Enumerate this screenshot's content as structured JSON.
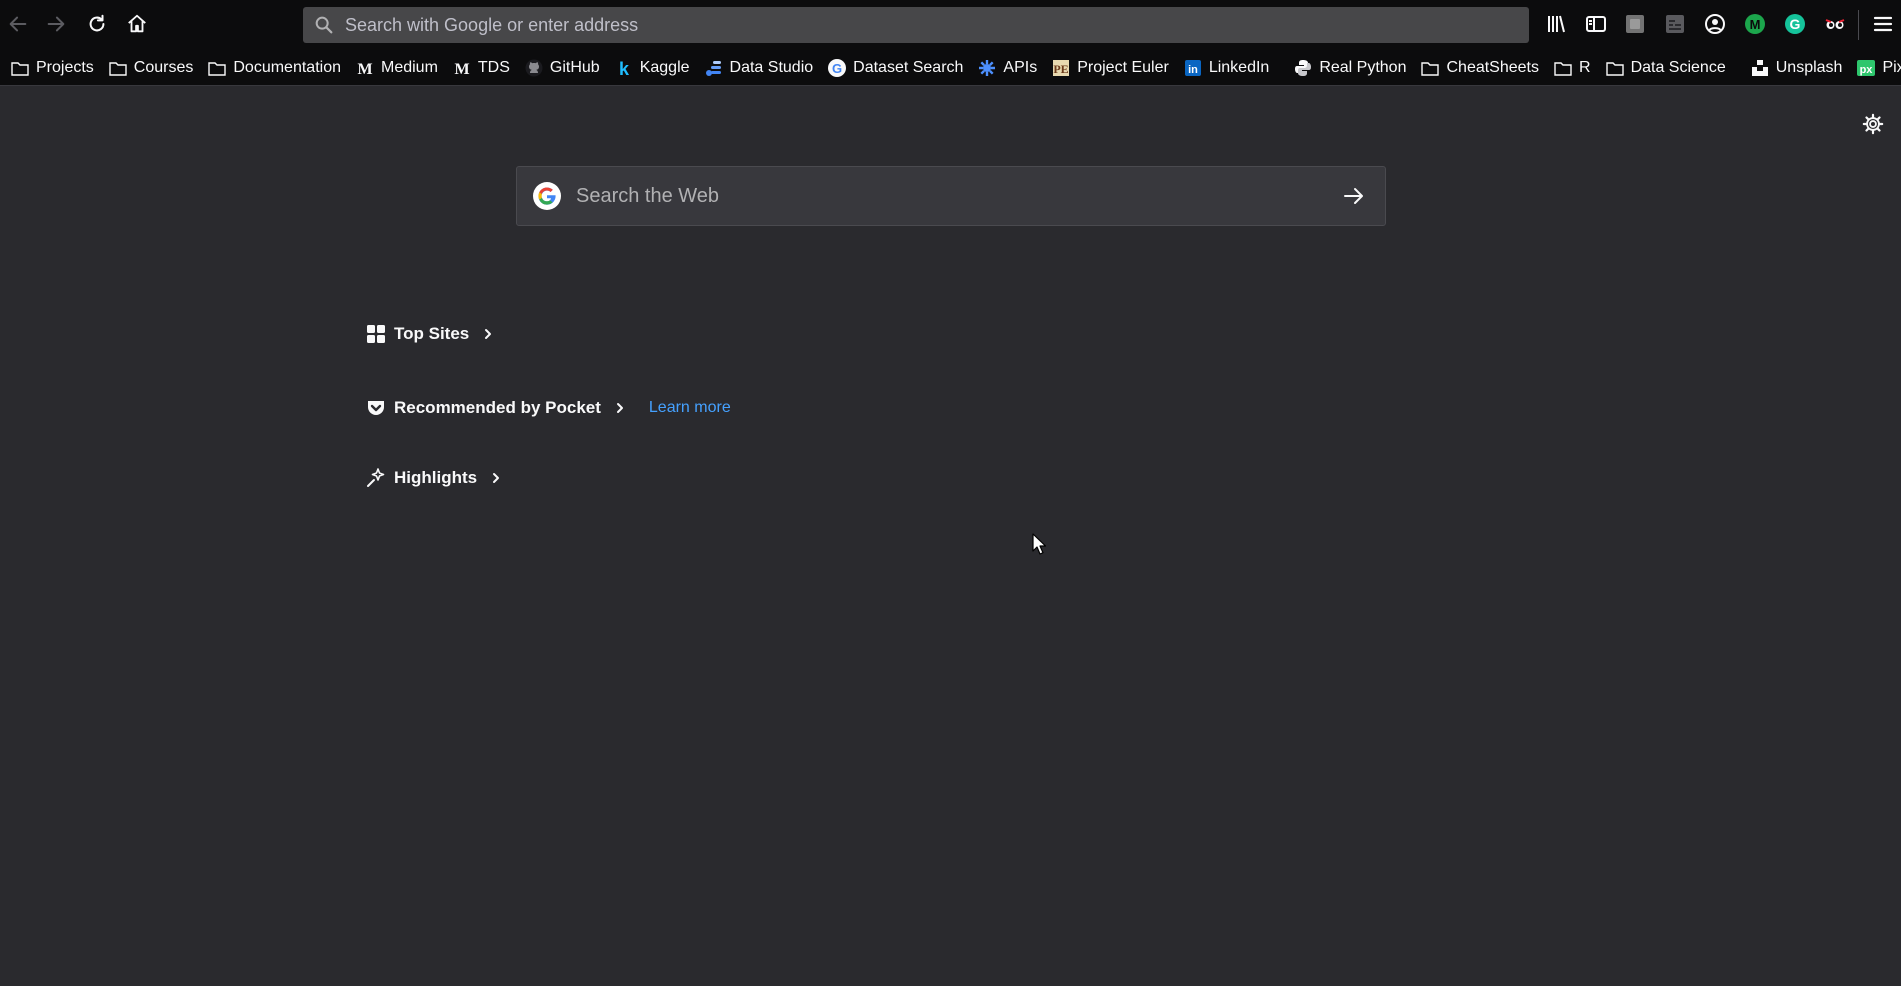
{
  "toolbar": {
    "back_icon": "arrow-left-icon",
    "forward_icon": "arrow-right-icon",
    "reload_icon": "reload-icon",
    "home_icon": "home-icon",
    "url_placeholder": "Search with Google or enter address",
    "right_icons": [
      "library-icon",
      "sidebar-icon",
      "pocket-save-icon",
      "container-icon",
      "account-icon",
      "extension-m-icon",
      "grammarly-icon",
      "extension-eyes-icon",
      "menu-icon"
    ]
  },
  "bookmarks": [
    {
      "label": "Projects",
      "icon": "folder-icon"
    },
    {
      "label": "Courses",
      "icon": "folder-icon"
    },
    {
      "label": "Documentation",
      "icon": "folder-icon"
    },
    {
      "label": "Medium",
      "icon": "medium-icon"
    },
    {
      "label": "TDS",
      "icon": "medium-icon"
    },
    {
      "label": "GitHub",
      "icon": "github-icon"
    },
    {
      "label": "Kaggle",
      "icon": "kaggle-icon"
    },
    {
      "label": "Data Studio",
      "icon": "data-studio-icon"
    },
    {
      "label": "Dataset Search",
      "icon": "google-icon"
    },
    {
      "label": "APIs",
      "icon": "apis-icon"
    },
    {
      "label": "Project Euler",
      "icon": "project-euler-icon"
    },
    {
      "label": "LinkedIn",
      "icon": "linkedin-icon"
    },
    {
      "label": "Real Python",
      "icon": "python-icon"
    },
    {
      "label": "CheatSheets",
      "icon": "folder-icon"
    },
    {
      "label": "R",
      "icon": "folder-icon"
    },
    {
      "label": "Data Science",
      "icon": "folder-icon"
    },
    {
      "label": "Unsplash",
      "icon": "unsplash-icon"
    },
    {
      "label": "Pixabay",
      "icon": "pixabay-icon"
    }
  ],
  "newtab": {
    "search_placeholder": "Search the Web",
    "sections": {
      "top_sites": "Top Sites",
      "pocket": "Recommended by Pocket",
      "pocket_learn_more": "Learn more",
      "highlights": "Highlights"
    }
  },
  "colors": {
    "background": "#2a2a2e",
    "toolbar": "#0c0c0d",
    "link": "#45a1ff"
  }
}
